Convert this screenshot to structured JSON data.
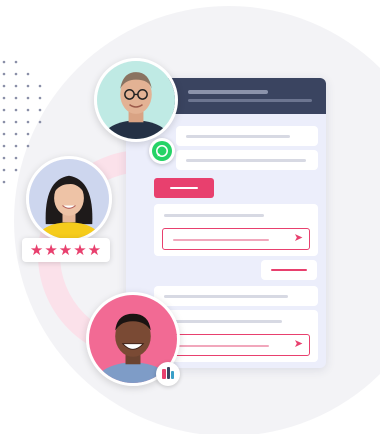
{
  "rating": {
    "stars": "★★★★★",
    "value": 5,
    "max": 5
  },
  "icons": {
    "whatsapp": "whatsapp-icon",
    "app": "app-logo-icon",
    "send": "send-arrow-icon",
    "star": "star-icon"
  },
  "send_glyph": "➤",
  "colors": {
    "accent_pink": "#e8406e",
    "panel_header": "#3a4460",
    "panel_bg": "#eceefb",
    "whatsapp_green": "#25d366"
  }
}
